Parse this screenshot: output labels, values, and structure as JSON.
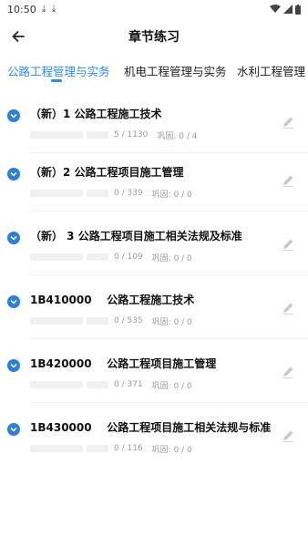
{
  "status": {
    "time": "10:50"
  },
  "app_bar": {
    "title": "章节练习"
  },
  "tabs": [
    {
      "label": "公路工程管理与实务",
      "active": true
    },
    {
      "label": "机电工程管理与实务",
      "active": false
    },
    {
      "label": "水利工程管理",
      "active": false
    }
  ],
  "accent_color": "#2d8cf0",
  "chapters": [
    {
      "title": "（新）1 公路工程施工技术",
      "progress": "5 / 1130",
      "consolidate": "巩固: 0 / 4"
    },
    {
      "title": "（新）2 公路工程项目施工管理",
      "progress": "0 / 339",
      "consolidate": "巩固: 0 / 0"
    },
    {
      "title": "（新） 3 公路工程项目施工相关法规及标准",
      "progress": "0 / 109",
      "consolidate": "巩固: 0 / 0"
    },
    {
      "title": "1B410000    公路工程施工技术",
      "progress": "0 / 535",
      "consolidate": "巩固: 0 / 0"
    },
    {
      "title": "1B420000    公路工程项目施工管理",
      "progress": "0 / 371",
      "consolidate": "巩固: 0 / 0"
    },
    {
      "title": "1B430000    公路工程项目施工相关法规与标准",
      "progress": "0 / 116",
      "consolidate": "巩固: 0 / 0"
    }
  ]
}
